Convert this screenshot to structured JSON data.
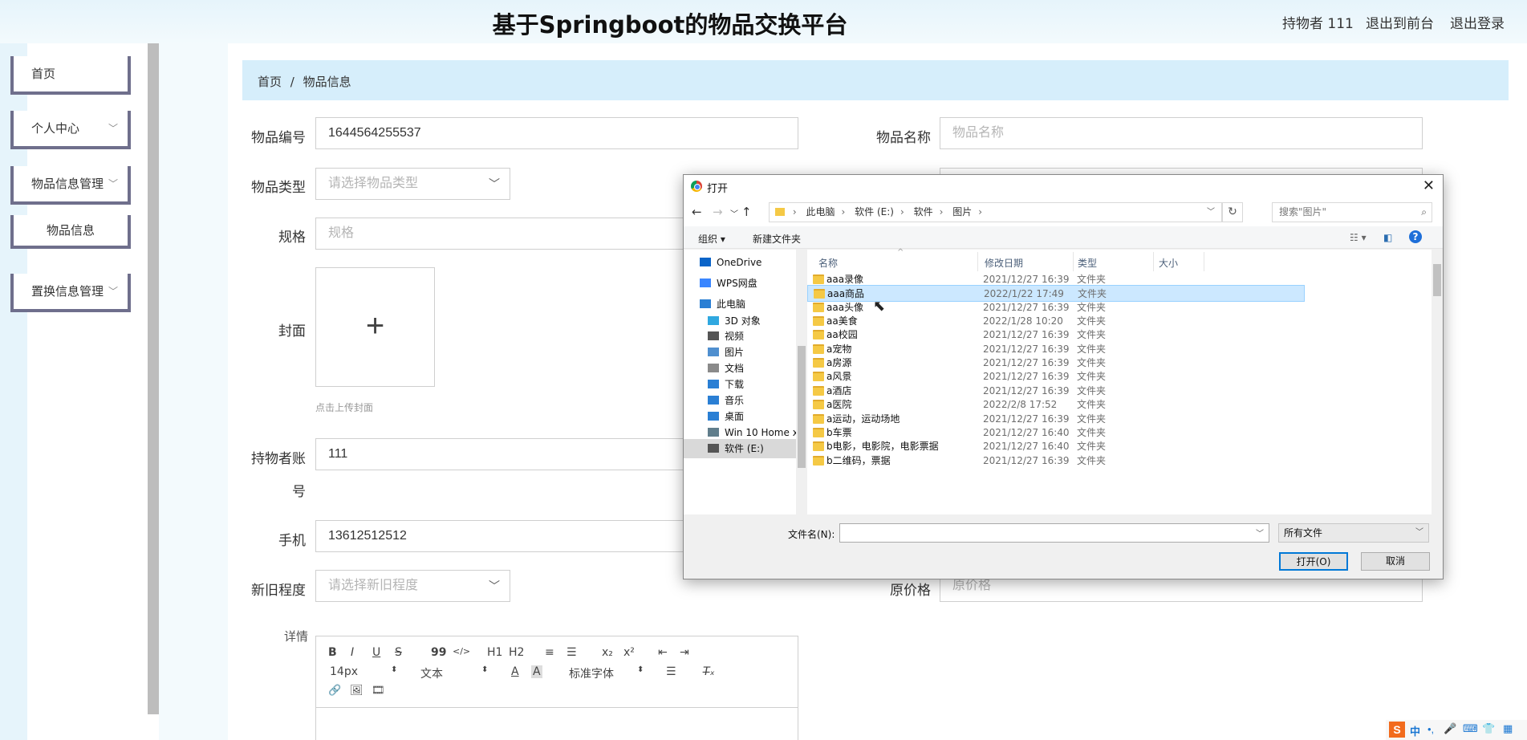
{
  "header": {
    "title": "基于Springboot的物品交换平台",
    "owner": "持物者 111",
    "back_front": "退出到前台",
    "logout": "退出登录"
  },
  "sidebar": {
    "items": [
      {
        "label": "首页",
        "has_chevron": false
      },
      {
        "label": "个人中心",
        "has_chevron": true
      },
      {
        "label": "物品信息管理",
        "has_chevron": true
      },
      {
        "label": "物品信息",
        "sub": true
      },
      {
        "label": "置换信息管理",
        "has_chevron": true
      }
    ]
  },
  "breadcrumb": {
    "home": "首页",
    "sep": "/",
    "current": "物品信息"
  },
  "form": {
    "item_no_label": "物品编号",
    "item_no_value": "1644564255537",
    "item_name_label": "物品名称",
    "item_name_placeholder": "物品名称",
    "item_type_label": "物品类型",
    "item_type_placeholder": "请选择物品类型",
    "spec_label": "规格",
    "spec_placeholder": "规格",
    "cover_label": "封面",
    "upload_plus": "+",
    "upload_hint": "点击上传封面",
    "account_label_1": "持物者账",
    "account_label_2": "号",
    "account_value": "111",
    "phone_label": "手机",
    "phone_value": "13612512512",
    "condition_label": "新旧程度",
    "condition_placeholder": "请选择新旧程度",
    "orig_price_label": "原价格",
    "orig_price_placeholder": "原价格",
    "detail_label": "详情"
  },
  "editor": {
    "row1": [
      "B",
      "I",
      "U",
      "S",
      "99",
      "</>",
      "H1",
      "H2",
      "≡",
      "☰",
      "x₂",
      "x²",
      "⇤",
      "⇥"
    ],
    "font_size": "14px",
    "block_type": "文本",
    "font_family": "标准字体",
    "row3": [
      "🔗",
      "🖼",
      "🎞"
    ]
  },
  "dialog": {
    "title": "打开",
    "path": [
      "此电脑",
      "软件 (E:)",
      "软件",
      "图片"
    ],
    "search_placeholder": "搜索\"图片\"",
    "organize": "组织 ▾",
    "new_folder": "新建文件夹",
    "nav_items": [
      {
        "label": "OneDrive",
        "color": "#0a64c8"
      },
      {
        "label": "WPS网盘",
        "color": "#3a86ff"
      },
      {
        "label": "此电脑",
        "color": "#2a7fd4"
      },
      {
        "label": "3D 对象",
        "color": "#2fa8e0"
      },
      {
        "label": "视频",
        "color": "#555555"
      },
      {
        "label": "图片",
        "color": "#4f8fcf"
      },
      {
        "label": "文档",
        "color": "#8a8a8a"
      },
      {
        "label": "下载",
        "color": "#2a7fd4"
      },
      {
        "label": "音乐",
        "color": "#2a7fd4"
      },
      {
        "label": "桌面",
        "color": "#2a7fd4"
      },
      {
        "label": "Win 10 Home x",
        "color": "#607d8b"
      },
      {
        "label": "软件 (E:)",
        "color": "#555555"
      }
    ],
    "columns": [
      "名称",
      "修改日期",
      "类型",
      "大小"
    ],
    "files": [
      {
        "name": "aaa录像",
        "date": "2021/12/27 16:39",
        "type": "文件夹"
      },
      {
        "name": "aaa商品",
        "date": "2022/1/22 17:49",
        "type": "文件夹",
        "selected": true
      },
      {
        "name": "aaa头像",
        "date": "2021/12/27 16:39",
        "type": "文件夹"
      },
      {
        "name": "aa美食",
        "date": "2022/1/28 10:20",
        "type": "文件夹"
      },
      {
        "name": "aa校园",
        "date": "2021/12/27 16:39",
        "type": "文件夹"
      },
      {
        "name": "a宠物",
        "date": "2021/12/27 16:39",
        "type": "文件夹"
      },
      {
        "name": "a房源",
        "date": "2021/12/27 16:39",
        "type": "文件夹"
      },
      {
        "name": "a风景",
        "date": "2021/12/27 16:39",
        "type": "文件夹"
      },
      {
        "name": "a酒店",
        "date": "2021/12/27 16:39",
        "type": "文件夹"
      },
      {
        "name": "a医院",
        "date": "2022/2/8 17:52",
        "type": "文件夹"
      },
      {
        "name": "a运动，运动场地",
        "date": "2021/12/27 16:39",
        "type": "文件夹"
      },
      {
        "name": "b车票",
        "date": "2021/12/27 16:40",
        "type": "文件夹"
      },
      {
        "name": "b电影，电影院，电影票据",
        "date": "2021/12/27 16:40",
        "type": "文件夹"
      },
      {
        "name": "b二维码，票据",
        "date": "2021/12/27 16:39",
        "type": "文件夹"
      }
    ],
    "filename_label": "文件名(N):",
    "filetype": "所有文件",
    "open_button": "打开(O)",
    "cancel_button": "取消"
  },
  "tray": {
    "ime": "中"
  }
}
